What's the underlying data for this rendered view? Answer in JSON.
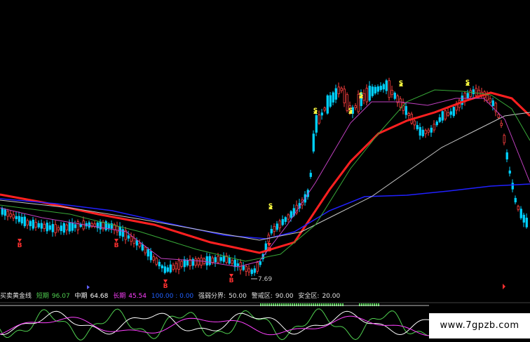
{
  "indicator_bar": {
    "name": "买卖黄金线",
    "short_label": "短期",
    "short_value": "96.07",
    "mid_label": "中期",
    "mid_value": "64.68",
    "long_label": "长期",
    "long_value": "45.54",
    "extra": "100.00 : 0.00",
    "strength_label": "强弱分界:",
    "strength_value": "50.00",
    "alert_label": "警戒区:",
    "alert_value": "90.00",
    "safe_label": "安全区:",
    "safe_value": "20.00"
  },
  "watermark": "www.7gpzb.com",
  "colors": {
    "up": "#ff4040",
    "down": "#00d2ff",
    "ma_red": "#ff2020",
    "ma_blue": "#2020ff",
    "ma_white": "#c8c8c8",
    "ma_green": "#38a838",
    "ma_magenta": "#c040c0",
    "signal_buy": "#ff3030",
    "signal_sell": "#ffff40",
    "short_line": "#50d050",
    "mid_line": "#ffffff",
    "long_line": "#ff40ff"
  },
  "chart_data": {
    "type": "candlestick",
    "title": "",
    "annotations": [
      {
        "label": "7.69",
        "note": "low price marker"
      }
    ],
    "signals": [
      "B",
      "B",
      "B",
      "B",
      "S",
      "B",
      "S",
      "S",
      "S",
      "S",
      "S"
    ],
    "indicator_lines": [
      "短期",
      "中期",
      "长期",
      "强弱分界",
      "警戒区",
      "安全区"
    ],
    "grid": false
  }
}
